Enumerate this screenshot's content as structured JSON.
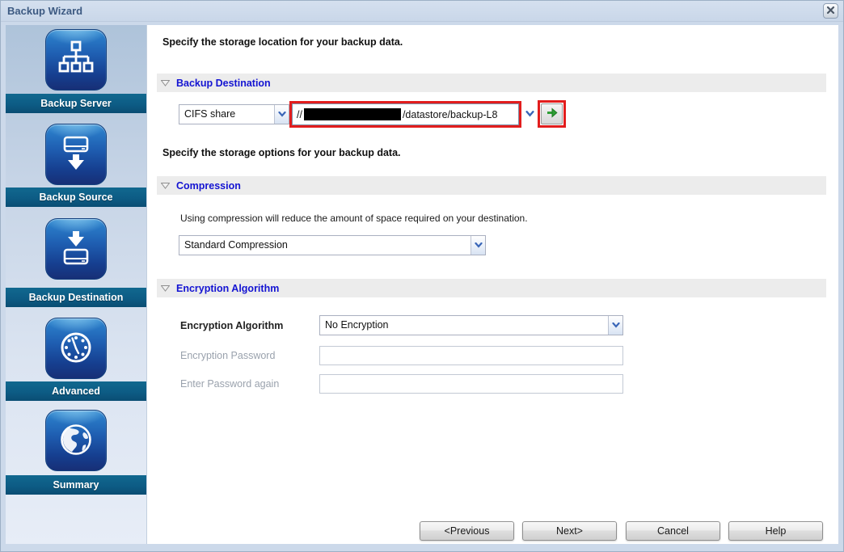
{
  "window": {
    "title": "Backup Wizard",
    "close_icon": "x-icon"
  },
  "sidebar": {
    "steps": [
      {
        "label": "Backup Server",
        "icon": "network-icon"
      },
      {
        "label": "Backup Source",
        "icon": "drive-down-arrow-icon"
      },
      {
        "label": "Backup Destination",
        "icon": "arrow-into-drive-icon"
      },
      {
        "label": "Advanced",
        "icon": "clock-icon"
      },
      {
        "label": "Summary",
        "icon": "globe-icon"
      }
    ]
  },
  "main": {
    "location_heading": "Specify the storage location for your backup data.",
    "backup_destination": {
      "section_title": "Backup Destination",
      "share_type_value": "CIFS share",
      "path_prefix": "//",
      "path_redacted": true,
      "path_suffix": "/datastore/backup-L8"
    },
    "options_heading": "Specify the storage options for your backup data.",
    "compression": {
      "section_title": "Compression",
      "description": "Using compression will reduce the amount of space required on your destination.",
      "value": "Standard Compression"
    },
    "encryption": {
      "section_title": "Encryption Algorithm",
      "algorithm_label": "Encryption Algorithm",
      "algorithm_value": "No Encryption",
      "password_label": "Encryption Password",
      "password_value": "",
      "confirm_label": "Enter Password again",
      "confirm_value": ""
    }
  },
  "footer": {
    "previous_label": "<Previous",
    "next_label": "Next>",
    "cancel_label": "Cancel",
    "help_label": "Help"
  },
  "colors": {
    "section_title_blue": "#1414d2",
    "step_bar_teal": "#0d5c85",
    "annotation_red": "#e21d1d",
    "arrow_green": "#2f9e35",
    "titlebar_blue": "#ccd9ea"
  }
}
